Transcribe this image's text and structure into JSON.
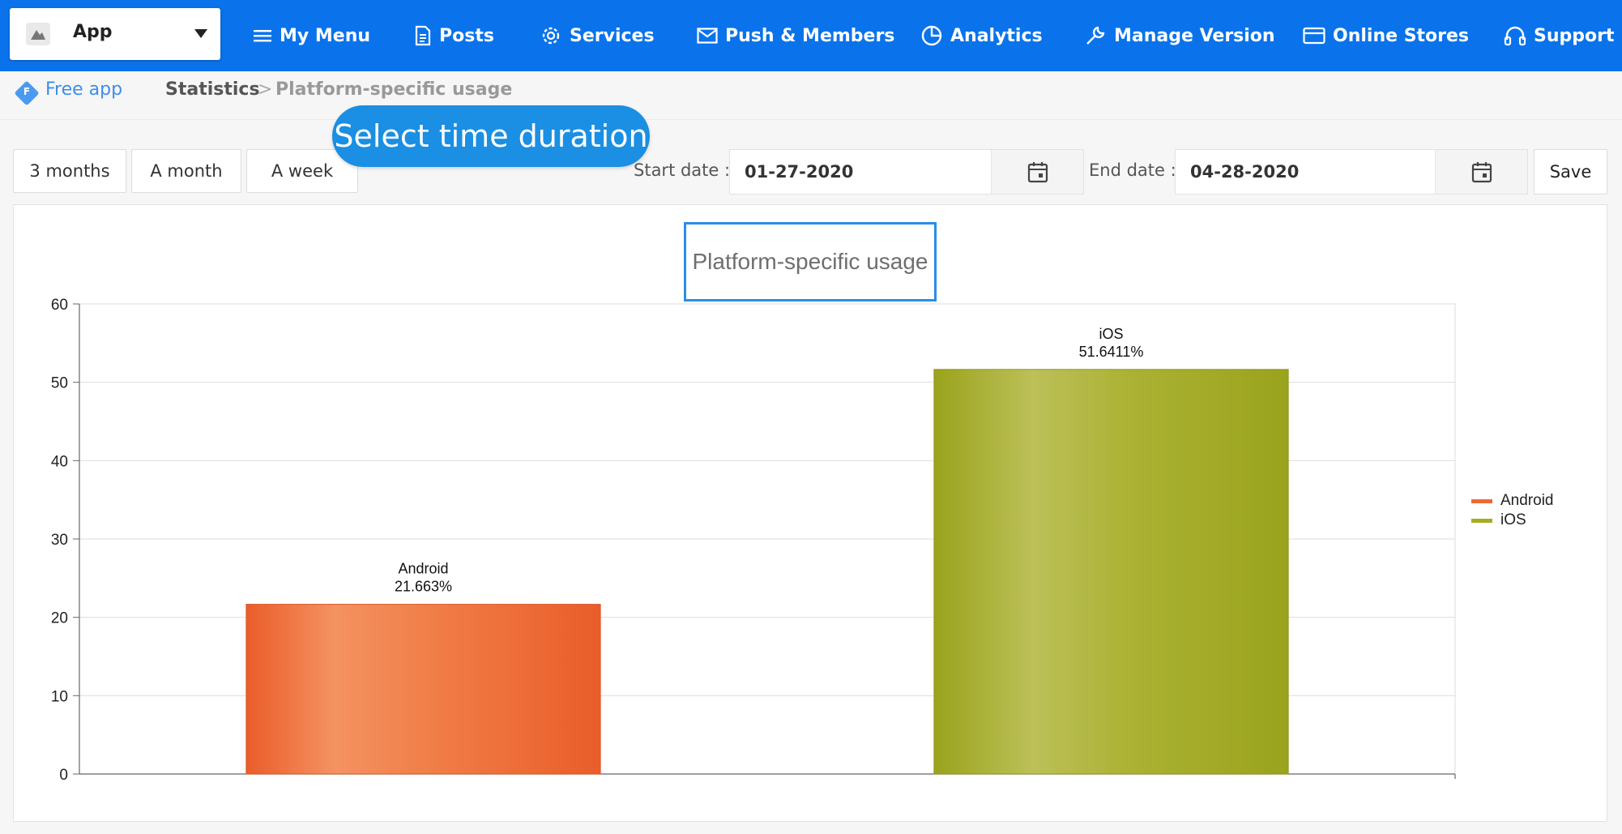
{
  "header": {
    "app_name": "App",
    "nav": [
      {
        "label": "My Menu",
        "icon": "menu-icon"
      },
      {
        "label": "Posts",
        "icon": "document-icon"
      },
      {
        "label": "Services",
        "icon": "gear-icon"
      },
      {
        "label": "Push & Members",
        "icon": "mail-icon"
      },
      {
        "label": "Analytics",
        "icon": "pie-chart-icon"
      },
      {
        "label": "Manage Version",
        "icon": "wrench-icon"
      },
      {
        "label": "Online Stores",
        "icon": "card-icon"
      },
      {
        "label": "Support",
        "icon": "headset-icon"
      }
    ],
    "bar_color": "#0a73eb"
  },
  "breadcrumb": {
    "plan_badge_letter": "F",
    "plan_label": "Free app",
    "section": "Statistics",
    "separator": ">",
    "page": "Platform-specific usage"
  },
  "callout": {
    "text": "Select time duration"
  },
  "filters": {
    "ranges": [
      "3 months",
      "A month",
      "A week"
    ],
    "start_label": "Start date :",
    "start_value": "01-27-2020",
    "end_label": "End date :",
    "end_value": "04-28-2020",
    "save_label": "Save"
  },
  "chart_data": {
    "type": "bar",
    "title": "Platform-specific usage",
    "categories": [
      "Android",
      "iOS"
    ],
    "values": [
      21.663,
      51.6411
    ],
    "data_labels": [
      "21.663%",
      "51.6411%"
    ],
    "colors": [
      "#ee6a33",
      "#a6ad23"
    ],
    "ylim": [
      0,
      60
    ],
    "yticks": [
      0,
      10,
      20,
      30,
      40,
      50,
      60
    ],
    "grid": true,
    "legend": {
      "position": "right",
      "entries": [
        "Android",
        "iOS"
      ]
    }
  }
}
